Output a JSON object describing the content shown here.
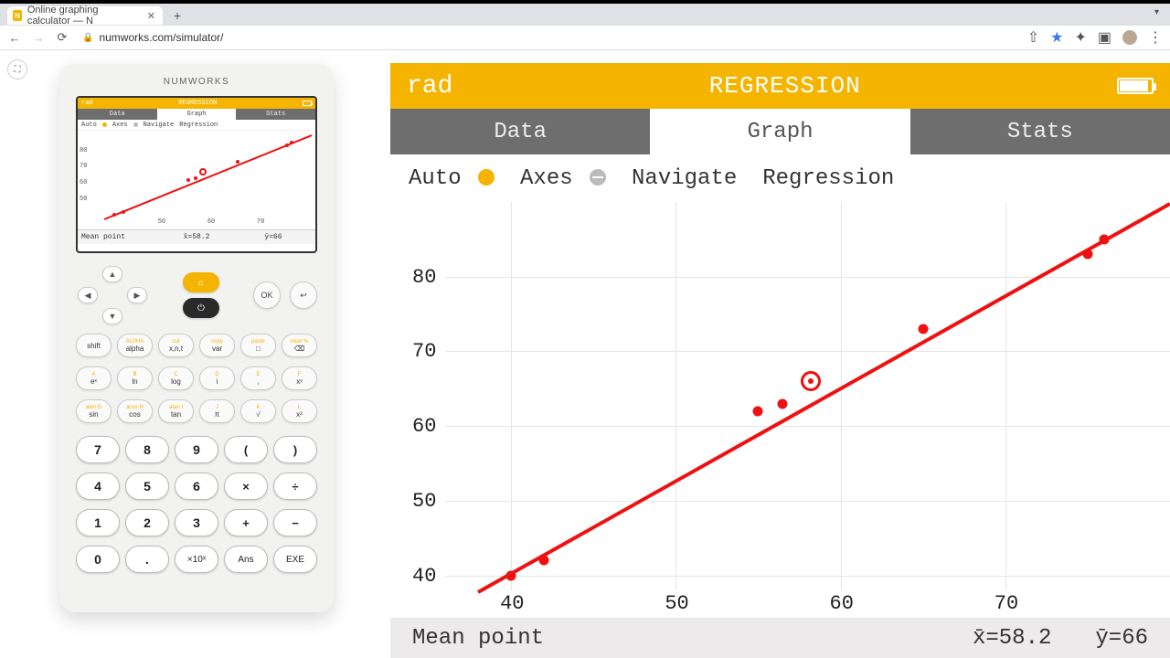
{
  "browser": {
    "tab_title": "Online graphing calculator — N",
    "url": "numworks.com/simulator/"
  },
  "device": {
    "brand": "NUMWORKS",
    "mini": {
      "rad": "rad",
      "title": "REGRESSION",
      "tabs": [
        "Data",
        "Graph",
        "Stats"
      ],
      "opts": [
        "Auto",
        "Axes",
        "Navigate",
        "Regression"
      ],
      "status": {
        "label": "Mean point",
        "xbar": "x̄=58.2",
        "ybar": "ȳ=66"
      },
      "xticks": [
        "50",
        "60",
        "70"
      ],
      "yticks": [
        "50",
        "60",
        "70",
        "80"
      ]
    },
    "keys_row1": [
      {
        "sup": "",
        "lab": "shift"
      },
      {
        "sup": "ALPHA",
        "lab": "alpha"
      },
      {
        "sup": "cut",
        "lab": "x,n,t"
      },
      {
        "sup": "copy",
        "lab": "var"
      },
      {
        "sup": "paste",
        "lab": "□"
      },
      {
        "sup": "clear %",
        "lab": "⌫"
      }
    ],
    "keys_row2": [
      {
        "sup": "A",
        "lab": "eˣ"
      },
      {
        "sup": "B",
        "lab": "ln"
      },
      {
        "sup": "C",
        "lab": "log"
      },
      {
        "sup": "D",
        "lab": "i"
      },
      {
        "sup": "E",
        "lab": ","
      },
      {
        "sup": "F",
        "lab": "xʸ"
      }
    ],
    "keys_row3": [
      {
        "sup": "asin G",
        "lab": "sin"
      },
      {
        "sup": "acos H",
        "lab": "cos"
      },
      {
        "sup": "atan I",
        "lab": "tan"
      },
      {
        "sup": "J",
        "lab": "π"
      },
      {
        "sup": "K",
        "lab": "√"
      },
      {
        "sup": "L",
        "lab": "x²"
      }
    ],
    "numrows": [
      [
        "7",
        "8",
        "9",
        "(",
        ")"
      ],
      [
        "4",
        "5",
        "6",
        "×",
        "÷"
      ],
      [
        "1",
        "2",
        "3",
        "+",
        "−"
      ],
      [
        "0",
        ".",
        "×10ˣ",
        "Ans",
        "EXE"
      ]
    ],
    "ok": "OK",
    "back": "↩"
  },
  "emu": {
    "rad": "rad",
    "title": "REGRESSION",
    "tabs": [
      "Data",
      "Graph",
      "Stats"
    ],
    "active_tab": 1,
    "opts": [
      "Auto",
      "Axes",
      "Navigate",
      "Regression"
    ],
    "status": {
      "label": "Mean point",
      "xbar": "x̄=58.2",
      "ybar": "ȳ=66"
    }
  },
  "chart_data": {
    "type": "scatter",
    "x": [
      40,
      42,
      55,
      56.5,
      58,
      65,
      75,
      76
    ],
    "y": [
      40,
      42,
      62,
      63,
      66,
      73,
      83,
      85
    ],
    "mean_point": {
      "x": 58.2,
      "y": 66
    },
    "regression": {
      "x1": 38,
      "y1": 38,
      "x2": 80,
      "y2": 90
    },
    "xlabel": "",
    "ylabel": "",
    "xticks": [
      40,
      50,
      60,
      70
    ],
    "yticks": [
      40,
      50,
      60,
      70,
      80
    ],
    "xlim": [
      36,
      80
    ],
    "ylim": [
      38,
      90
    ]
  }
}
